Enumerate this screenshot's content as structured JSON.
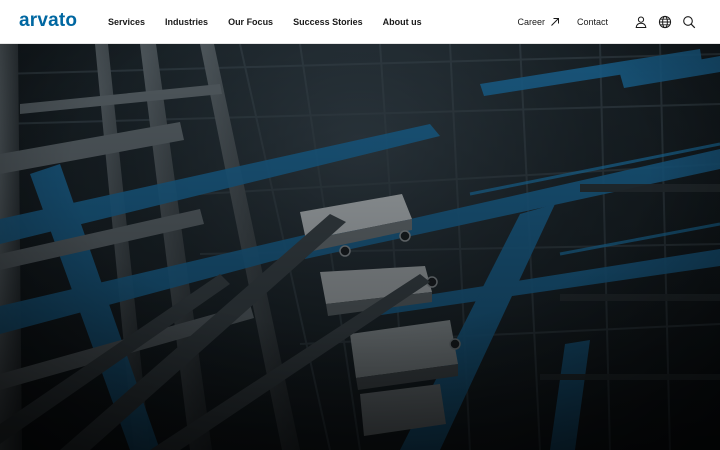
{
  "brand": {
    "name": "arvato",
    "color": "#0067a1"
  },
  "nav": {
    "items": [
      {
        "id": "services",
        "label": "Services"
      },
      {
        "id": "industries",
        "label": "Industries"
      },
      {
        "id": "our-focus",
        "label": "Our Focus"
      },
      {
        "id": "success-stories",
        "label": "Success Stories"
      },
      {
        "id": "about-us",
        "label": "About us"
      }
    ]
  },
  "utility": {
    "career_label": "Career",
    "contact_label": "Contact",
    "icons": [
      "external-arrow-icon",
      "user-icon",
      "globe-icon",
      "search-icon"
    ]
  },
  "hero": {
    "image_subject": "automated warehouse shuttle racks",
    "tint": "#0f1a20",
    "accent": "#1e7fb8"
  }
}
